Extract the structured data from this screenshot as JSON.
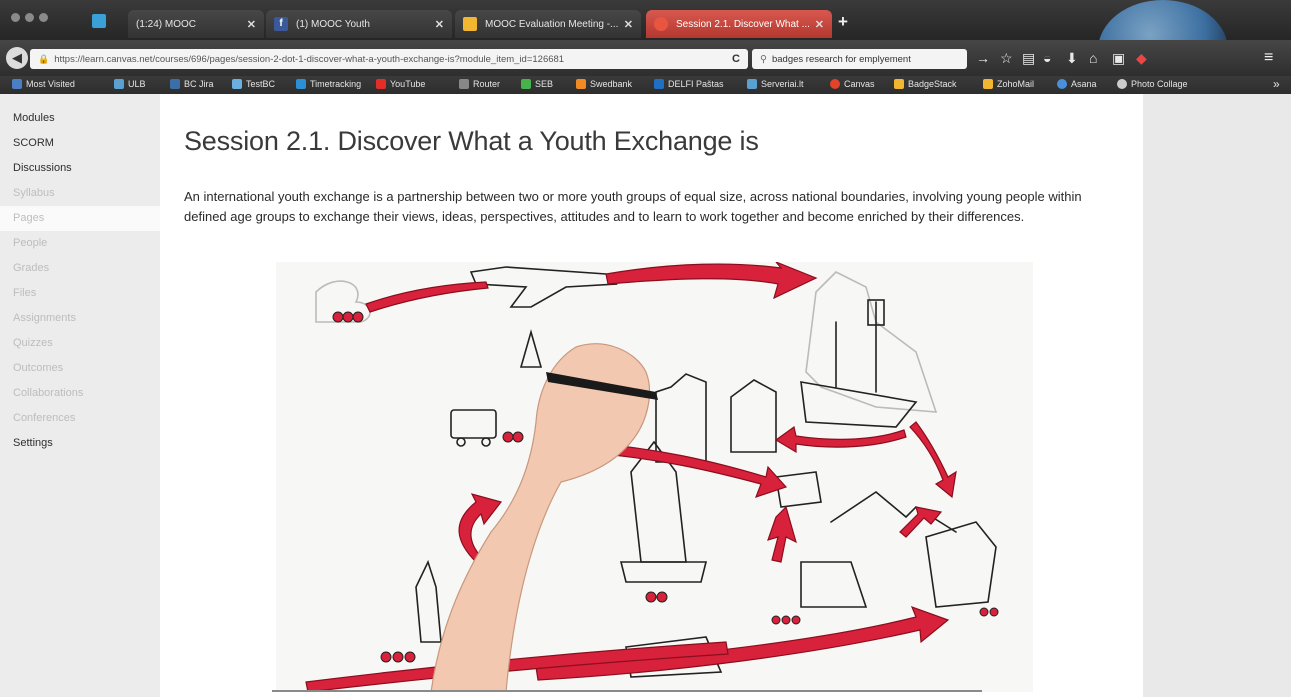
{
  "browser": {
    "tabs": [
      {
        "label": "(1:24) MOOC",
        "favicon_color": "#3aa0d8",
        "active": false
      },
      {
        "label": "(1) MOOC Youth",
        "favicon_color": "#3b5998",
        "active": false
      },
      {
        "label": "MOOC Evaluation Meeting -...",
        "favicon_color": "#f2b630",
        "active": false
      },
      {
        "label": "Session 2.1. Discover What ...",
        "favicon_color": "#e8563f",
        "active": true
      }
    ],
    "new_tab_icon": "+",
    "url": "https://learn.canvas.net/courses/696/pages/session-2-dot-1-discover-what-a-youth-exchange-is?module_item_id=126681",
    "search_value": "badges research for emplyement",
    "bookmarks": [
      {
        "label": "Most Visited",
        "color": "#4a7fc1"
      },
      {
        "label": "ULB",
        "color": "#5aa0d0"
      },
      {
        "label": "BC Jira",
        "color": "#3c6ea8"
      },
      {
        "label": "TestBC",
        "color": "#6ab0e0"
      },
      {
        "label": "Timetracking",
        "color": "#2c8fd6"
      },
      {
        "label": "YouTube",
        "color": "#e52d27"
      },
      {
        "label": "Router",
        "color": "#888888"
      },
      {
        "label": "SEB",
        "color": "#47b34a"
      },
      {
        "label": "Swedbank",
        "color": "#f08a24"
      },
      {
        "label": "DELFI Paštas",
        "color": "#1f6fc2"
      },
      {
        "label": "Serveriai.lt",
        "color": "#5aa0d0"
      },
      {
        "label": "Canvas",
        "color": "#e2432a"
      },
      {
        "label": "BadgeStack",
        "color": "#f2b630"
      },
      {
        "label": "ZohoMail",
        "color": "#f2b630"
      },
      {
        "label": "Asana",
        "color": "#4a90d9"
      },
      {
        "label": "Photo Collage",
        "color": "#cccccc"
      }
    ],
    "overflow_icon": "»"
  },
  "sidebar": {
    "items": [
      {
        "label": "Modules",
        "state": "enabled"
      },
      {
        "label": "SCORM",
        "state": "enabled"
      },
      {
        "label": "Discussions",
        "state": "enabled"
      },
      {
        "label": "Syllabus",
        "state": "disabled"
      },
      {
        "label": "Pages",
        "state": "active"
      },
      {
        "label": "People",
        "state": "disabled"
      },
      {
        "label": "Grades",
        "state": "disabled"
      },
      {
        "label": "Files",
        "state": "disabled"
      },
      {
        "label": "Assignments",
        "state": "disabled"
      },
      {
        "label": "Quizzes",
        "state": "disabled"
      },
      {
        "label": "Outcomes",
        "state": "disabled"
      },
      {
        "label": "Collaborations",
        "state": "disabled"
      },
      {
        "label": "Conferences",
        "state": "disabled"
      },
      {
        "label": "Settings",
        "state": "enabled"
      }
    ]
  },
  "main": {
    "title": "Session 2.1. Discover What a Youth Exchange is",
    "intro": "An international youth exchange is a partnership between two or more youth groups of equal size, across national boundaries, involving young people within defined age groups to exchange their views, ideas, perspectives, attitudes and to learn to work together and become enriched by their differences."
  },
  "colors": {
    "accent_red": "#d8213a",
    "active_tab": "#c8453c"
  }
}
